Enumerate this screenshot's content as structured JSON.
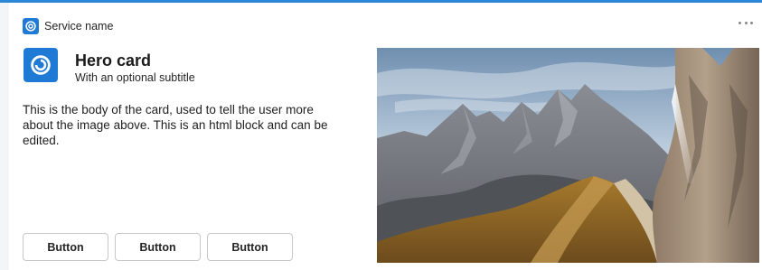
{
  "header": {
    "service_name": "Service name",
    "service_icon": "service-logo-icon",
    "more_icon": "more-horizontal-icon"
  },
  "card": {
    "title": "Hero card",
    "subtitle": "With an optional subtitle",
    "body": "This is the body of the card, used to tell the user more about the image above. This is an html block and can be edited.",
    "image": "mountain-landscape-image"
  },
  "buttons": [
    {
      "label": "Button"
    },
    {
      "label": "Button"
    },
    {
      "label": "Button"
    }
  ],
  "colors": {
    "accent": "#1f7ad6",
    "top_strip": "#2b86d6",
    "button_border": "#c8c8c8"
  }
}
